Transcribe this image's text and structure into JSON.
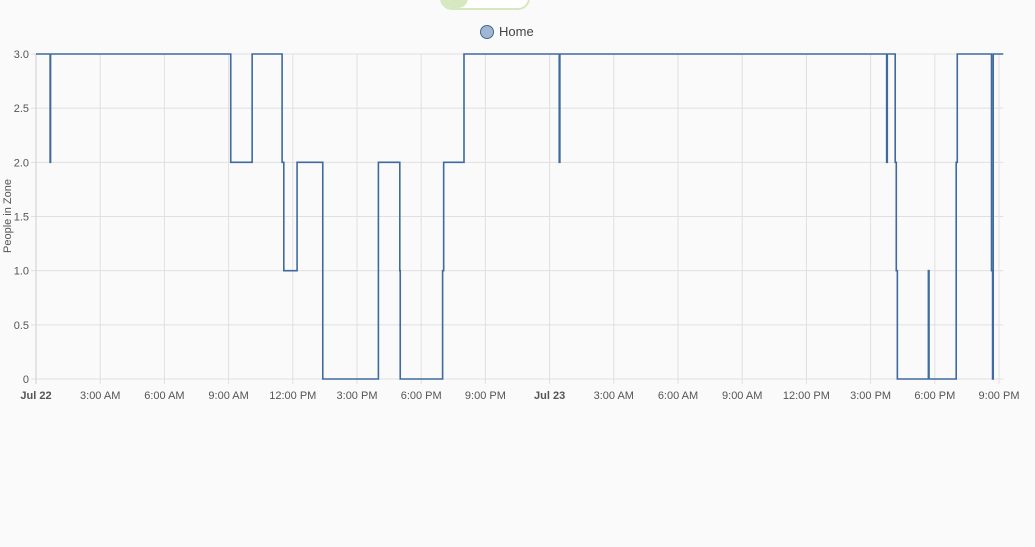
{
  "chart_data": {
    "type": "line",
    "step": true,
    "legend": [
      "Home"
    ],
    "legend_position": "top-center",
    "ylabel": "People in Zone",
    "ylim": [
      0,
      3
    ],
    "yticks": [
      "0",
      "0.5",
      "1.0",
      "1.5",
      "2.0",
      "2.5",
      "3.0"
    ],
    "xlim_hours": [
      0,
      45.2
    ],
    "xticks": [
      {
        "h": 0,
        "label": "Jul 22",
        "bold": true
      },
      {
        "h": 3,
        "label": "3:00 AM"
      },
      {
        "h": 6,
        "label": "6:00 AM"
      },
      {
        "h": 9,
        "label": "9:00 AM"
      },
      {
        "h": 12,
        "label": "12:00 PM"
      },
      {
        "h": 15,
        "label": "3:00 PM"
      },
      {
        "h": 18,
        "label": "6:00 PM"
      },
      {
        "h": 21,
        "label": "9:00 PM"
      },
      {
        "h": 24,
        "label": "Jul 23",
        "bold": true
      },
      {
        "h": 27,
        "label": "3:00 AM"
      },
      {
        "h": 30,
        "label": "6:00 AM"
      },
      {
        "h": 33,
        "label": "9:00 AM"
      },
      {
        "h": 36,
        "label": "12:00 PM"
      },
      {
        "h": 39,
        "label": "3:00 PM"
      },
      {
        "h": 42,
        "label": "6:00 PM"
      },
      {
        "h": 45,
        "label": "9:00 PM"
      }
    ],
    "grid": true,
    "series": [
      {
        "name": "Home",
        "color": "#3e6a9e",
        "points_hours_value": [
          [
            0,
            3
          ],
          [
            0.66,
            2
          ],
          [
            0.68,
            3
          ],
          [
            9.1,
            2
          ],
          [
            10.1,
            3
          ],
          [
            11.5,
            2
          ],
          [
            11.58,
            1
          ],
          [
            12.2,
            2
          ],
          [
            13.4,
            0
          ],
          [
            16.0,
            2
          ],
          [
            17.0,
            1
          ],
          [
            17.02,
            0
          ],
          [
            19.0,
            1
          ],
          [
            19.05,
            2
          ],
          [
            20.0,
            3
          ],
          [
            24.45,
            2
          ],
          [
            24.48,
            3
          ],
          [
            39.75,
            2
          ],
          [
            39.78,
            3
          ],
          [
            40.15,
            2
          ],
          [
            40.2,
            1
          ],
          [
            40.25,
            0
          ],
          [
            41.7,
            1
          ],
          [
            41.73,
            0
          ],
          [
            43.0,
            2
          ],
          [
            43.05,
            3
          ],
          [
            44.65,
            1
          ],
          [
            44.7,
            0
          ],
          [
            44.73,
            3
          ],
          [
            45.2,
            3
          ]
        ]
      }
    ]
  }
}
